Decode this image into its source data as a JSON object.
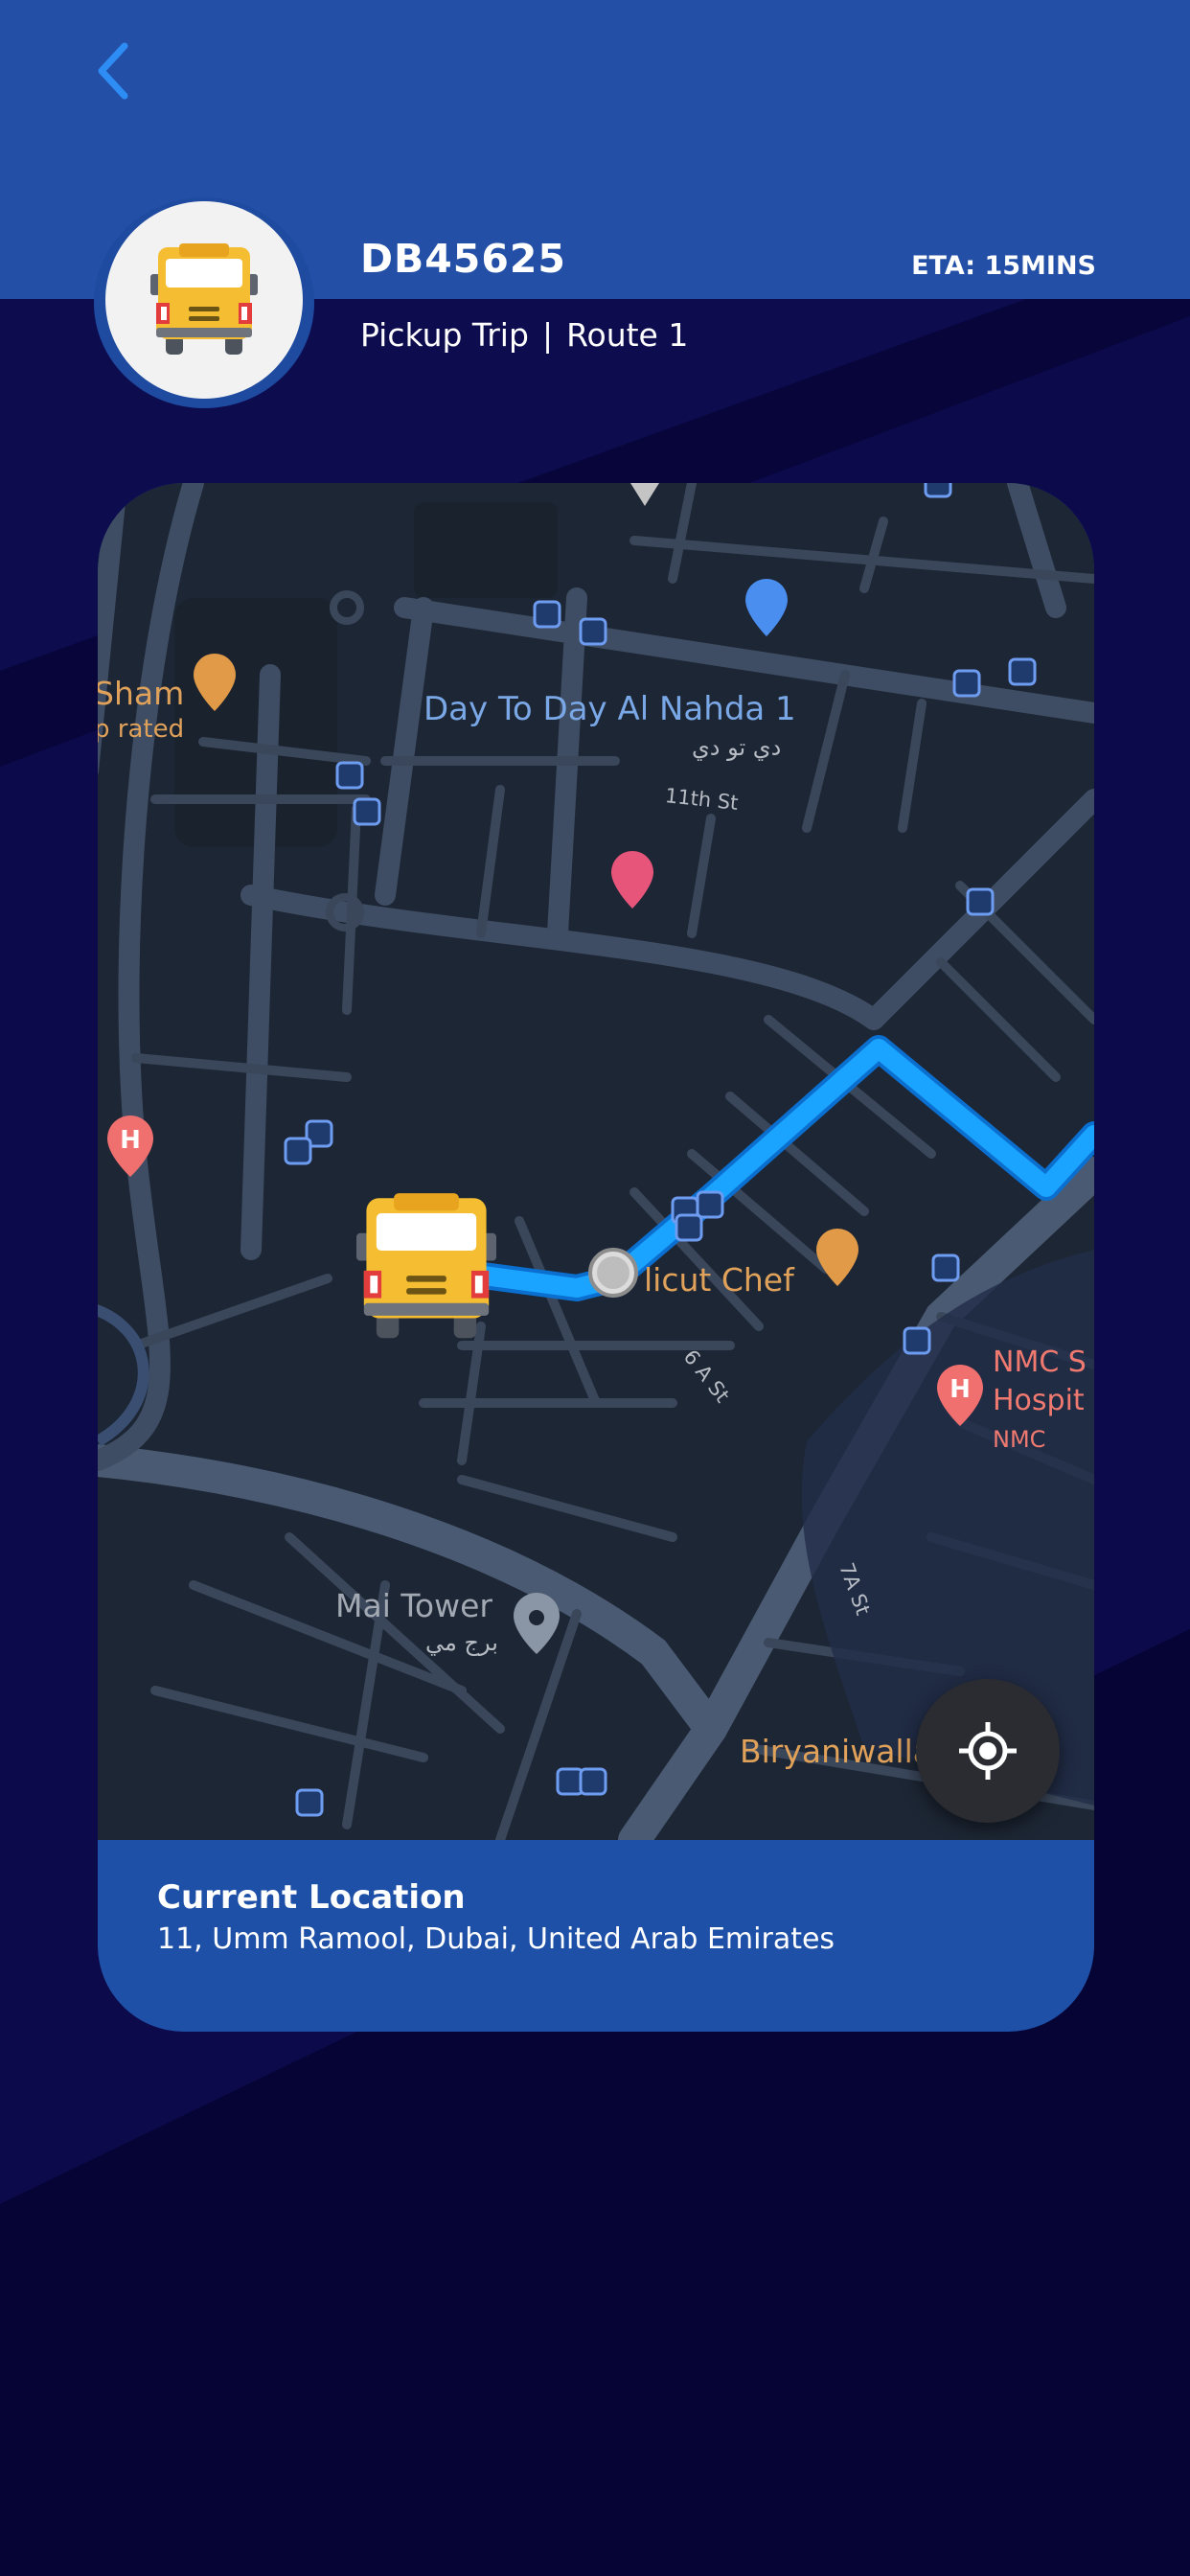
{
  "header": {
    "bus_number": "DB45625",
    "eta": "ETA: 15MINS",
    "trip_type": "Pickup Trip",
    "separator": "|",
    "route": "Route 1"
  },
  "icons": {
    "back": "chevron-left-icon",
    "avatar": "school-bus-icon",
    "locate": "my-location-icon",
    "bus_marker": "school-bus-icon"
  },
  "map": {
    "labels": {
      "poi_day_to_day": "Day To Day Al Nahda 1",
      "poi_day_to_day_arabic": "دي تو دي",
      "street_11th": "11th St",
      "poi_sham": "Sham",
      "poi_sham_rated": "p rated",
      "poi_calicut": "licut Chef",
      "street_6a": "6 A St",
      "poi_nmc": "NMC S",
      "poi_nmc_hospital": "Hospit",
      "poi_nmc_sub": "NMC",
      "street_7a": "7A St",
      "poi_mai_tower": "Mai Tower",
      "poi_mai_tower_arabic": "برج مي",
      "poi_biryaniwalla": "Biryaniwalla"
    }
  },
  "current_location": {
    "title": "Current Location",
    "address": "11, Umm Ramool, Dubai, United Arab Emirates"
  },
  "colors": {
    "header_blue": "#2350a6",
    "background_navy": "#07053a",
    "route_blue": "#1aa3ff",
    "map_background": "#1d2634"
  }
}
